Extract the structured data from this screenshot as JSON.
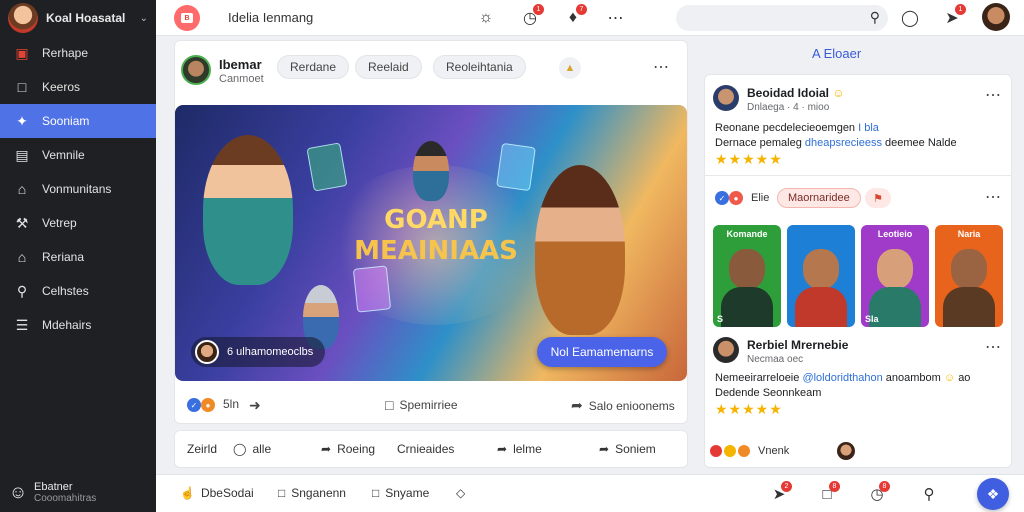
{
  "sidebar": {
    "title": "Koal Hoasatal",
    "items": [
      {
        "label": "Rerhape",
        "icon": "photos-icon"
      },
      {
        "label": "Keeros",
        "icon": "square-icon"
      },
      {
        "label": "Sooniam",
        "icon": "puzzle-icon"
      },
      {
        "label": "Vemnile",
        "icon": "image-icon"
      },
      {
        "label": "Vonmunitans",
        "icon": "community-icon"
      },
      {
        "label": "Vetrep",
        "icon": "tools-icon"
      },
      {
        "label": "Reriana",
        "icon": "home-icon"
      },
      {
        "label": "Celhstes",
        "icon": "search-icon"
      },
      {
        "label": "Mdehairs",
        "icon": "list-icon"
      }
    ],
    "active_index": 2,
    "footer": {
      "title": "Ebatner",
      "subtitle": "Cooomahitras"
    }
  },
  "topbar": {
    "title": "Idelia Ienmang",
    "badges": [
      "1",
      "7",
      "1"
    ]
  },
  "post": {
    "author": "Ibemar",
    "subtitle": "Canmoet",
    "chips": [
      "Rerdane",
      "Reelaid",
      "Reoleihtania"
    ],
    "banner_title_line1": "GOANP",
    "banner_title_line2": "MEAINIAAS",
    "banner_footer": "6 ulhamomeoclbs",
    "cta_label": "Nol Eamamemarns",
    "reaction_count": "5ln",
    "comment_label": "Spemirriee",
    "share_label": "Salo enioonems"
  },
  "action_row": {
    "items": [
      "Zeirld",
      "alle",
      "Roeing",
      "Crnieaides",
      "lelme",
      "Soniem"
    ]
  },
  "bottombar": {
    "items": [
      "DbeSodai",
      "Snganenn",
      "Snyame"
    ],
    "badges": [
      "2",
      "8",
      "8"
    ]
  },
  "right_panel": {
    "header": "A Eloaer",
    "post1": {
      "name": "Beoidad Idoial",
      "meta": "Dnlaega · 4 · mioo",
      "line1_pre": "Reonane pecdelecieoemgen",
      "line1_hl": "I bla",
      "line2_pre": "Dernace pemaleg",
      "line2_hl": "dheapsrecieess",
      "line2_post": "deemee Nalde",
      "rating": 5
    },
    "reactions": {
      "count": "Elie",
      "pill": "Maornaridee"
    },
    "tiles": [
      {
        "label": "Komande",
        "footer": "S",
        "color": "#2e9e3a"
      },
      {
        "label": "",
        "footer": "",
        "color": "#1e7fd6"
      },
      {
        "label": "Leotieio",
        "footer": "Sla",
        "color": "#a03ac8"
      },
      {
        "label": "Naria",
        "footer": "",
        "color": "#e8641c"
      }
    ],
    "post2": {
      "name": "Rerbiel Mrernebie",
      "meta": "Necmaa oec",
      "line1_pre": "Nemeeirarreloeie",
      "line1_hl": "@loldoridthahon",
      "line1_post": "anoambom",
      "line1_end": "ao",
      "line2": "Dedende Seonnkeam",
      "rating": 5
    },
    "footer_label": "Vnenk"
  },
  "colors": {
    "sidebar_bg": "#1f2023",
    "accent": "#4f72e6",
    "cta": "#4a63e8",
    "star": "#f5b400"
  }
}
